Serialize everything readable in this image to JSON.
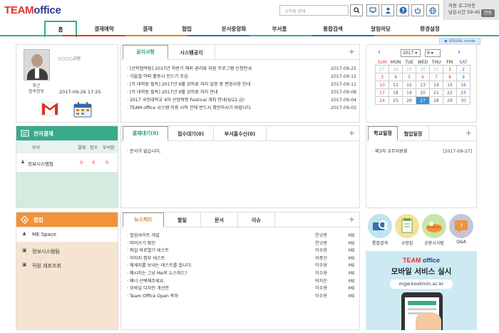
{
  "app": {
    "logo_team": "TEAM",
    "logo_office": "office"
  },
  "header": {
    "search_placeholder": "교직원 검색",
    "auto_logout": "자동 로그아웃",
    "time_left": "남은시간 59:45",
    "logout_btn": "연장"
  },
  "nav": [
    "홈",
    "결재예약",
    "결재",
    "협업",
    "문서중앙화",
    "부서홈",
    "통합검색",
    "알림마당",
    "환경설정"
  ],
  "nav_colors": [
    "#3aaa8a",
    "#e4322b",
    "#e4322b",
    "#e07c1a",
    "#2f6ab5",
    "#3aaa8a",
    "#2f6ab5",
    "#e07c1a",
    "#3aaa8a"
  ],
  "profile": {
    "name": "○○○○교원",
    "last_label": "최근\n접속정보",
    "last_time": "2017-09-26 17:25"
  },
  "notice": {
    "tabs": [
      "공지사항",
      "시스템공지"
    ],
    "items": [
      {
        "t": "[산학협력팀] 2017년 하반기 해외 권리화 지원 프로그램 신청안내",
        "d": "2017-09-25"
      },
      {
        "t": "가을철 야외 활동시 진드기 조심",
        "d": "2017-09-15"
      },
      {
        "t": "[각 대학원 필독] 2017년 9월 강의료 처리 일정 중 변경사항 안내",
        "d": "2017-09-11"
      },
      {
        "t": "[각 대학원 필독] 2017년 9월 강의료 처리 안내",
        "d": "2017-09-08"
      },
      {
        "t": "2017 국민대학교 4차 산업혁명 Festival 개최 안내(9/22,금)",
        "d": "2017-09-04"
      },
      {
        "t": "TEAM office 시스템 이용 시작 전에 반드시 확인하시기 바랍니다.",
        "d": "2017-09-03"
      }
    ]
  },
  "calendar": {
    "visual_mode": "VISUAL mode",
    "year": "2017",
    "month": "9",
    "days": [
      "SUN",
      "MON",
      "TUE",
      "WED",
      "THU",
      "FRI",
      "SAT"
    ],
    "weeks": [
      [
        "27",
        "28",
        "29",
        "30",
        "31",
        "1",
        "2"
      ],
      [
        "3",
        "4",
        "5",
        "6",
        "7",
        "8",
        "9"
      ],
      [
        "10",
        "11",
        "12",
        "13",
        "14",
        "15",
        "16"
      ],
      [
        "17",
        "18",
        "19",
        "20",
        "21",
        "22",
        "23"
      ],
      [
        "24",
        "25",
        "26",
        "27",
        "28",
        "29",
        "30"
      ]
    ]
  },
  "approval": {
    "title": "전자결재",
    "cols": [
      "부서",
      "결재",
      "접수",
      "부서함"
    ],
    "row": {
      "dept": "정보시스템팀",
      "a": "0",
      "b": "0",
      "c": "0"
    },
    "tabs": [
      "결재대기(0)",
      "접수대기(0)",
      "부서홈수신(0)"
    ],
    "empty": "문서가 없습니다."
  },
  "schedule": {
    "tabs": [
      "학교일정",
      "협업일정"
    ],
    "items": [
      {
        "t": "제3차 교무위원회",
        "d": "[2017-09-27]"
      }
    ]
  },
  "collab": {
    "title": "협업",
    "items": [
      "ME Space",
      "정보시스템팀",
      "직원 레포츠회"
    ],
    "tabs": [
      "뉴스피드",
      "할일",
      "문서",
      "이슈"
    ],
    "feed": [
      {
        "t": "협업사이트 개설",
        "w": "연규종",
        "g": "ME"
      },
      {
        "t": "띄어쓰기 확인",
        "w": "연규종",
        "g": "ME"
      },
      {
        "t": "파일 바로열기 테스트",
        "w": "이수용",
        "g": "ME"
      },
      {
        "t": "이미지 첨부 테스트",
        "w": "라종선",
        "g": "ME"
      },
      {
        "t": "메세지를 보내는 테스트를 합니다.",
        "w": "이수용",
        "g": "ME"
      },
      {
        "t": "메시지는 그냥 Me의 뉴스피드?",
        "w": "이수용",
        "g": "ME"
      },
      {
        "t": "배너 선택해주세요.",
        "w": "박지은",
        "g": "ME"
      },
      {
        "t": "모바일 디자인 개선안",
        "w": "이수용",
        "g": "ME"
      },
      {
        "t": "Team Office Open 축하",
        "w": "이수용",
        "g": "ME"
      }
    ]
  },
  "quick": [
    "통합검색",
    "규정집",
    "공용시식팀",
    "Q&A"
  ],
  "banner": {
    "logo_team": "TEAM",
    "logo_office": "office",
    "title": "모바일 서비스 실시",
    "url": "mgw.kookmin.ac.kr"
  }
}
